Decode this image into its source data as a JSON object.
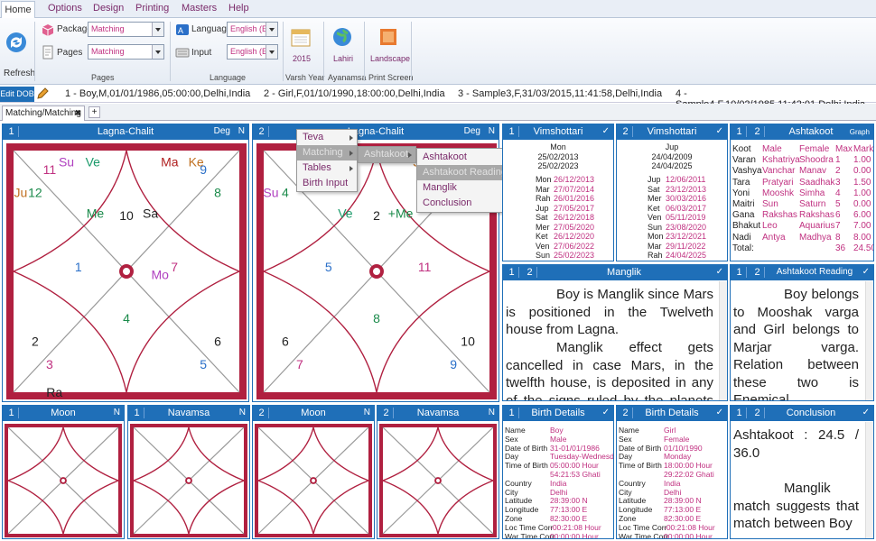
{
  "menubar": {
    "items": [
      "Home",
      "Options",
      "Design",
      "Printing",
      "Masters",
      "Help"
    ]
  },
  "ribbon": {
    "refresh": "Refresh",
    "package_label": "Package",
    "package_value": "Matching",
    "pages_label": "Pages",
    "pages_value": "Matching",
    "pages_group": "Pages",
    "language_label": "Language",
    "language_value": "English (E",
    "input_label": "Input",
    "input_value": "English (E",
    "language_group": "Language",
    "year": "2015",
    "varsh": "Varsh Year",
    "lahiri": "Lahiri",
    "ayanamsa": "Ayanamsa",
    "landscape": "Landscape",
    "print_screen": "Print Screen"
  },
  "editbar": {
    "button": "Edit DOB",
    "entries": [
      "1 - Boy,M,01/01/1986,05:00:00,Delhi,India",
      "2 - Girl,F,01/10/1990,18:00:00,Delhi,India",
      "3 - Sample3,F,31/03/2015,11:41:58,Delhi,India",
      "4 - Sample4,F,10/02/1985,11:42:01,Delhi,India"
    ]
  },
  "tab": {
    "label": "Matching/Matching",
    "close": "✖",
    "add": "+"
  },
  "lagna1": {
    "num": "1",
    "title": "Lagna-Chalit",
    "deg": "Deg",
    "n": "N",
    "signs": [
      "10",
      "11",
      "12",
      "1",
      "2",
      "3",
      "4",
      "5",
      "6",
      "7",
      "8",
      "9"
    ],
    "planets": [
      {
        "t": "Su",
        "c": "#b040c0"
      },
      {
        "t": "Ve",
        "c": "#1a9a6a"
      },
      {
        "t": "Ma",
        "c": "#b02020"
      },
      {
        "t": "Ke",
        "c": "#c07020"
      },
      {
        "t": "Ju",
        "c": "#c07020"
      },
      {
        "t": "Me",
        "c": "#1a8a4a"
      },
      {
        "t": "Sa",
        "c": "#222"
      },
      {
        "t": "Mo",
        "c": "#b040c0"
      },
      {
        "t": "Ra",
        "c": "#222"
      }
    ]
  },
  "lagna2": {
    "num": "2",
    "title": "Lagna-Chalit",
    "deg": "Deg",
    "n": "N",
    "signs": [
      "2",
      "3",
      "4",
      "5",
      "6",
      "7",
      "8",
      "9",
      "10",
      "11",
      "12",
      "1"
    ],
    "planets": [
      {
        "t": "Ma",
        "c": "#b02020"
      },
      {
        "t": "Ke",
        "c": "#c07020"
      },
      {
        "t": "Ju",
        "c": "#c07020"
      },
      {
        "t": "Sa",
        "c": "#222"
      },
      {
        "t": "Su",
        "c": "#b040c0"
      },
      {
        "t": "Ve",
        "c": "#1a9a6a"
      },
      {
        "t": "+Me",
        "c": "#1a8a4a"
      }
    ]
  },
  "context_menu": {
    "items": [
      "Teva",
      "Matching",
      "Tables",
      "Birth Input"
    ],
    "sub1": [
      "Ashtakoot"
    ],
    "sub2": [
      "Ashtakoot",
      "Ashtakoot Reading",
      "Manglik",
      "Conclusion"
    ]
  },
  "vim1": {
    "num": "1",
    "title": "Vimshottari",
    "check": "✓",
    "head": "Mon",
    "from": "25/02/2013",
    "to": "25/02/2023",
    "rows": [
      [
        "Mon",
        "26/12/2013"
      ],
      [
        "Mar",
        "27/07/2014"
      ],
      [
        "Rah",
        "26/01/2016"
      ],
      [
        "Jup",
        "27/05/2017"
      ],
      [
        "Sat",
        "26/12/2018"
      ],
      [
        "Mer",
        "27/05/2020"
      ],
      [
        "Ket",
        "26/12/2020"
      ],
      [
        "Ven",
        "27/06/2022"
      ],
      [
        "Sun",
        "25/02/2023"
      ]
    ]
  },
  "vim2": {
    "num": "2",
    "title": "Vimshottari",
    "check": "✓",
    "head": "Jup",
    "from": "24/04/2009",
    "to": "24/04/2025",
    "rows": [
      [
        "Jup",
        "12/06/2011"
      ],
      [
        "Sat",
        "23/12/2013"
      ],
      [
        "Mer",
        "30/03/2016"
      ],
      [
        "Ket",
        "06/03/2017"
      ],
      [
        "Ven",
        "05/11/2019"
      ],
      [
        "Sun",
        "23/08/2020"
      ],
      [
        "Mon",
        "23/12/2021"
      ],
      [
        "Mar",
        "29/11/2022"
      ],
      [
        "Rah",
        "24/04/2025"
      ]
    ]
  },
  "ashtakoot": {
    "n1": "1",
    "n2": "2",
    "title": "Ashtakoot",
    "graph": "Graph",
    "headers": [
      "Koot",
      "Male",
      "Female",
      "Max",
      "Mark"
    ],
    "rows": [
      [
        "Varan",
        "Kshatriya",
        "Shoodra",
        "1",
        "1.00"
      ],
      [
        "Vashya",
        "Vanchar",
        "Manav",
        "2",
        "0.00"
      ],
      [
        "Tara",
        "Pratyari",
        "Saadhak",
        "3",
        "1.50"
      ],
      [
        "Yoni",
        "Mooshk",
        "Simha",
        "4",
        "1.00"
      ],
      [
        "Maitri",
        "Sun",
        "Saturn",
        "5",
        "0.00"
      ],
      [
        "Gana",
        "Rakshas",
        "Rakshas",
        "6",
        "6.00"
      ],
      [
        "Bhakut",
        "Leo",
        "Aquarius",
        "7",
        "7.00"
      ],
      [
        "Nadi",
        "Antya",
        "Madhya",
        "8",
        "8.00"
      ]
    ],
    "total_label": "Total:",
    "total_max": "36",
    "total_mark": "24.50"
  },
  "manglik": {
    "n1": "1",
    "n2": "2",
    "title": "Manglik",
    "check": "✓",
    "p1": "Boy is Manglik since Mars is positioned in the Twelveth house from Lagna.",
    "p2": "Manglik effect gets cancelled in case Mars, in the twelfth house, is deposited in any of the signs ruled by the planets Mars"
  },
  "reading": {
    "n1": "1",
    "n2": "2",
    "title": "Ashtakoot Reading",
    "check": "✓",
    "text": "Boy belongs to Mooshak varga and Girl belongs to Marjar varga. Relation between these two is Enemical."
  },
  "mini": [
    {
      "num": "1",
      "title": "Moon",
      "n": "N"
    },
    {
      "num": "1",
      "title": "Navamsa",
      "n": "N"
    },
    {
      "num": "2",
      "title": "Moon",
      "n": "N"
    },
    {
      "num": "2",
      "title": "Navamsa",
      "n": "N"
    }
  ],
  "birth1": {
    "num": "1",
    "title": "Birth Details",
    "check": "✓",
    "rows": [
      [
        "Name",
        "Boy"
      ],
      [
        "Sex",
        "Male"
      ],
      [
        "Date of Birth",
        "31-01/01/1986"
      ],
      [
        "Day",
        "Tuesday-Wednesday"
      ],
      [
        "Time of Birth",
        "05:00:00 Hour"
      ],
      [
        "",
        "54:21:53 Ghati"
      ],
      [
        "Country",
        "India"
      ],
      [
        "City",
        "Delhi"
      ],
      [
        "Latitude",
        "28:39:00 N"
      ],
      [
        "Longitude",
        "77:13:00 E"
      ],
      [
        "Zone",
        "82:30:00 E"
      ],
      [
        "Loc Time Corr",
        "-00:21:08 Hour"
      ],
      [
        "War Time Corr",
        "00:00:00 Hour"
      ]
    ]
  },
  "birth2": {
    "num": "2",
    "title": "Birth Details",
    "check": "✓",
    "rows": [
      [
        "Name",
        "Girl"
      ],
      [
        "Sex",
        "Female"
      ],
      [
        "Date of Birth",
        "01/10/1990"
      ],
      [
        "Day",
        "Monday"
      ],
      [
        "Time of Birth",
        "18:00:00 Hour"
      ],
      [
        "",
        "29:22:02 Ghati"
      ],
      [
        "Country",
        "India"
      ],
      [
        "City",
        "Delhi"
      ],
      [
        "Latitude",
        "28:39:00 N"
      ],
      [
        "Longitude",
        "77:13:00 E"
      ],
      [
        "Zone",
        "82:30:00 E"
      ],
      [
        "Loc Time Corr",
        "-00:21:08 Hour"
      ],
      [
        "War Time Corr",
        "00:00:00 Hour"
      ]
    ]
  },
  "conclusion": {
    "n1": "1",
    "n2": "2",
    "title": "Conclusion",
    "check": "✓",
    "score": "Ashtakoot : 24.5 / 36.0",
    "text": "Manglik match suggests that match between Boy"
  }
}
